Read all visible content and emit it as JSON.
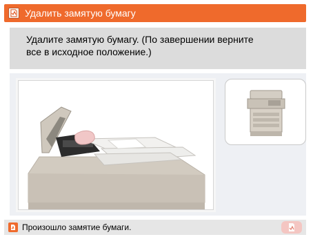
{
  "titlebar": {
    "title": "Удалить замятую бумагу",
    "icon": "paper-jam-icon",
    "color": "#ef6a2c"
  },
  "message": {
    "line1": "Удалите замятую бумагу. (По завершении верните",
    "line2": "все в исходное положение.)"
  },
  "illustration": {
    "icon": "printer-open-adf-illustration"
  },
  "thumbnail": {
    "icon": "printer-thumbnail"
  },
  "statusbar": {
    "text": "Произошло замятие бумаги.",
    "icon": "paper-jam-icon",
    "button_icon": "paper-jam-icon"
  }
}
